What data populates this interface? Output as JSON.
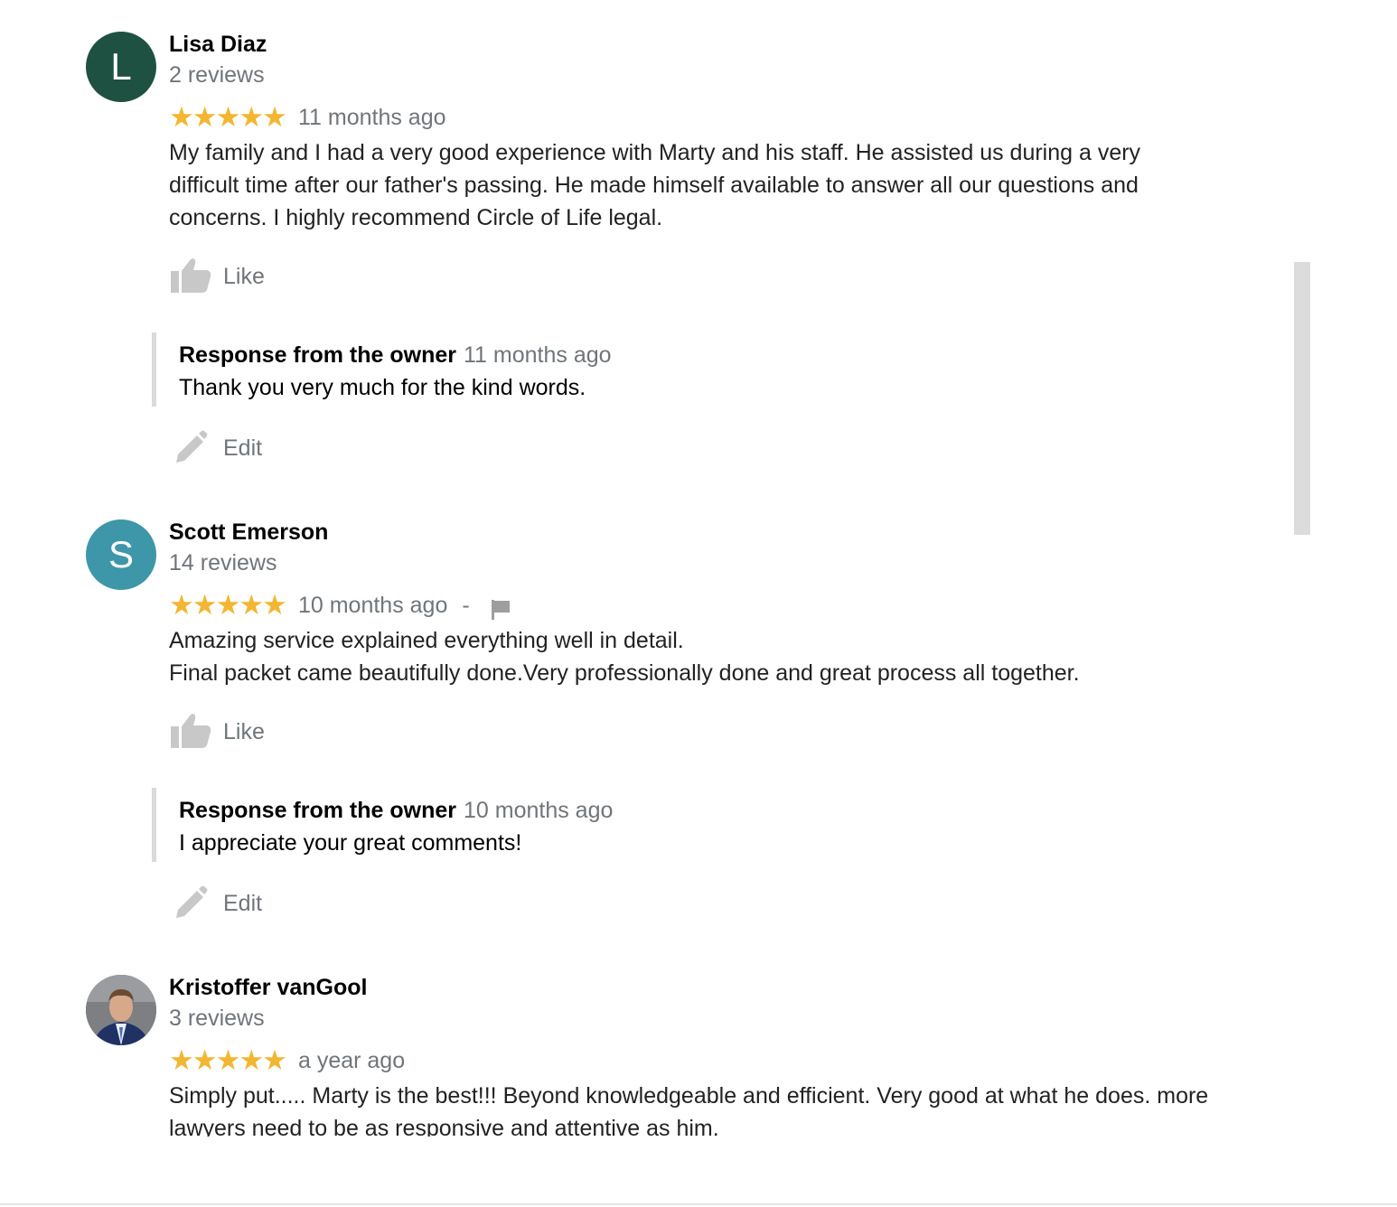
{
  "colors": {
    "star": "#f2b632",
    "muted": "#70757a",
    "icon_gray": "#c8c8c8"
  },
  "reviews": [
    {
      "avatar_letter": "L",
      "avatar_color": "#1f5142",
      "name": "Lisa Diaz",
      "review_count": "2 reviews",
      "rating": 5,
      "stars": "★★★★★",
      "date": "11 months ago",
      "text": "My family and I had a very good experience with Marty and his staff. He assisted us during a very\ndifficult time after our father's passing. He made himself available to answer all our questions and\nconcerns. I highly recommend Circle of Life legal.",
      "like_label": "Like",
      "response": {
        "title": "Response from the owner",
        "date": "11 months ago",
        "text": "Thank you very much for the kind words."
      },
      "edit_label": "Edit"
    },
    {
      "avatar_letter": "S",
      "avatar_color": "#3d97a8",
      "name": "Scott Emerson",
      "review_count": "14 reviews",
      "rating": 5,
      "stars": "★★★★★",
      "date": "10 months ago",
      "separator": "-",
      "text": "Amazing service explained everything well in detail.\nFinal packet came beautifully done.Very professionally done and great process all together.",
      "like_label": "Like",
      "response": {
        "title": "Response from the owner",
        "date": "10 months ago",
        "text": "I appreciate your great comments!"
      },
      "edit_label": "Edit"
    },
    {
      "avatar_icon": "profile-photo",
      "name": "Kristoffer vanGool",
      "review_count": "3 reviews",
      "rating": 5,
      "stars": "★★★★★",
      "date": "a year ago",
      "text": "Simply put..... Marty is the best!!! Beyond knowledgeable and efficient. Very good at what he does.  more\nlawyers need to be as responsive and attentive as him."
    }
  ]
}
